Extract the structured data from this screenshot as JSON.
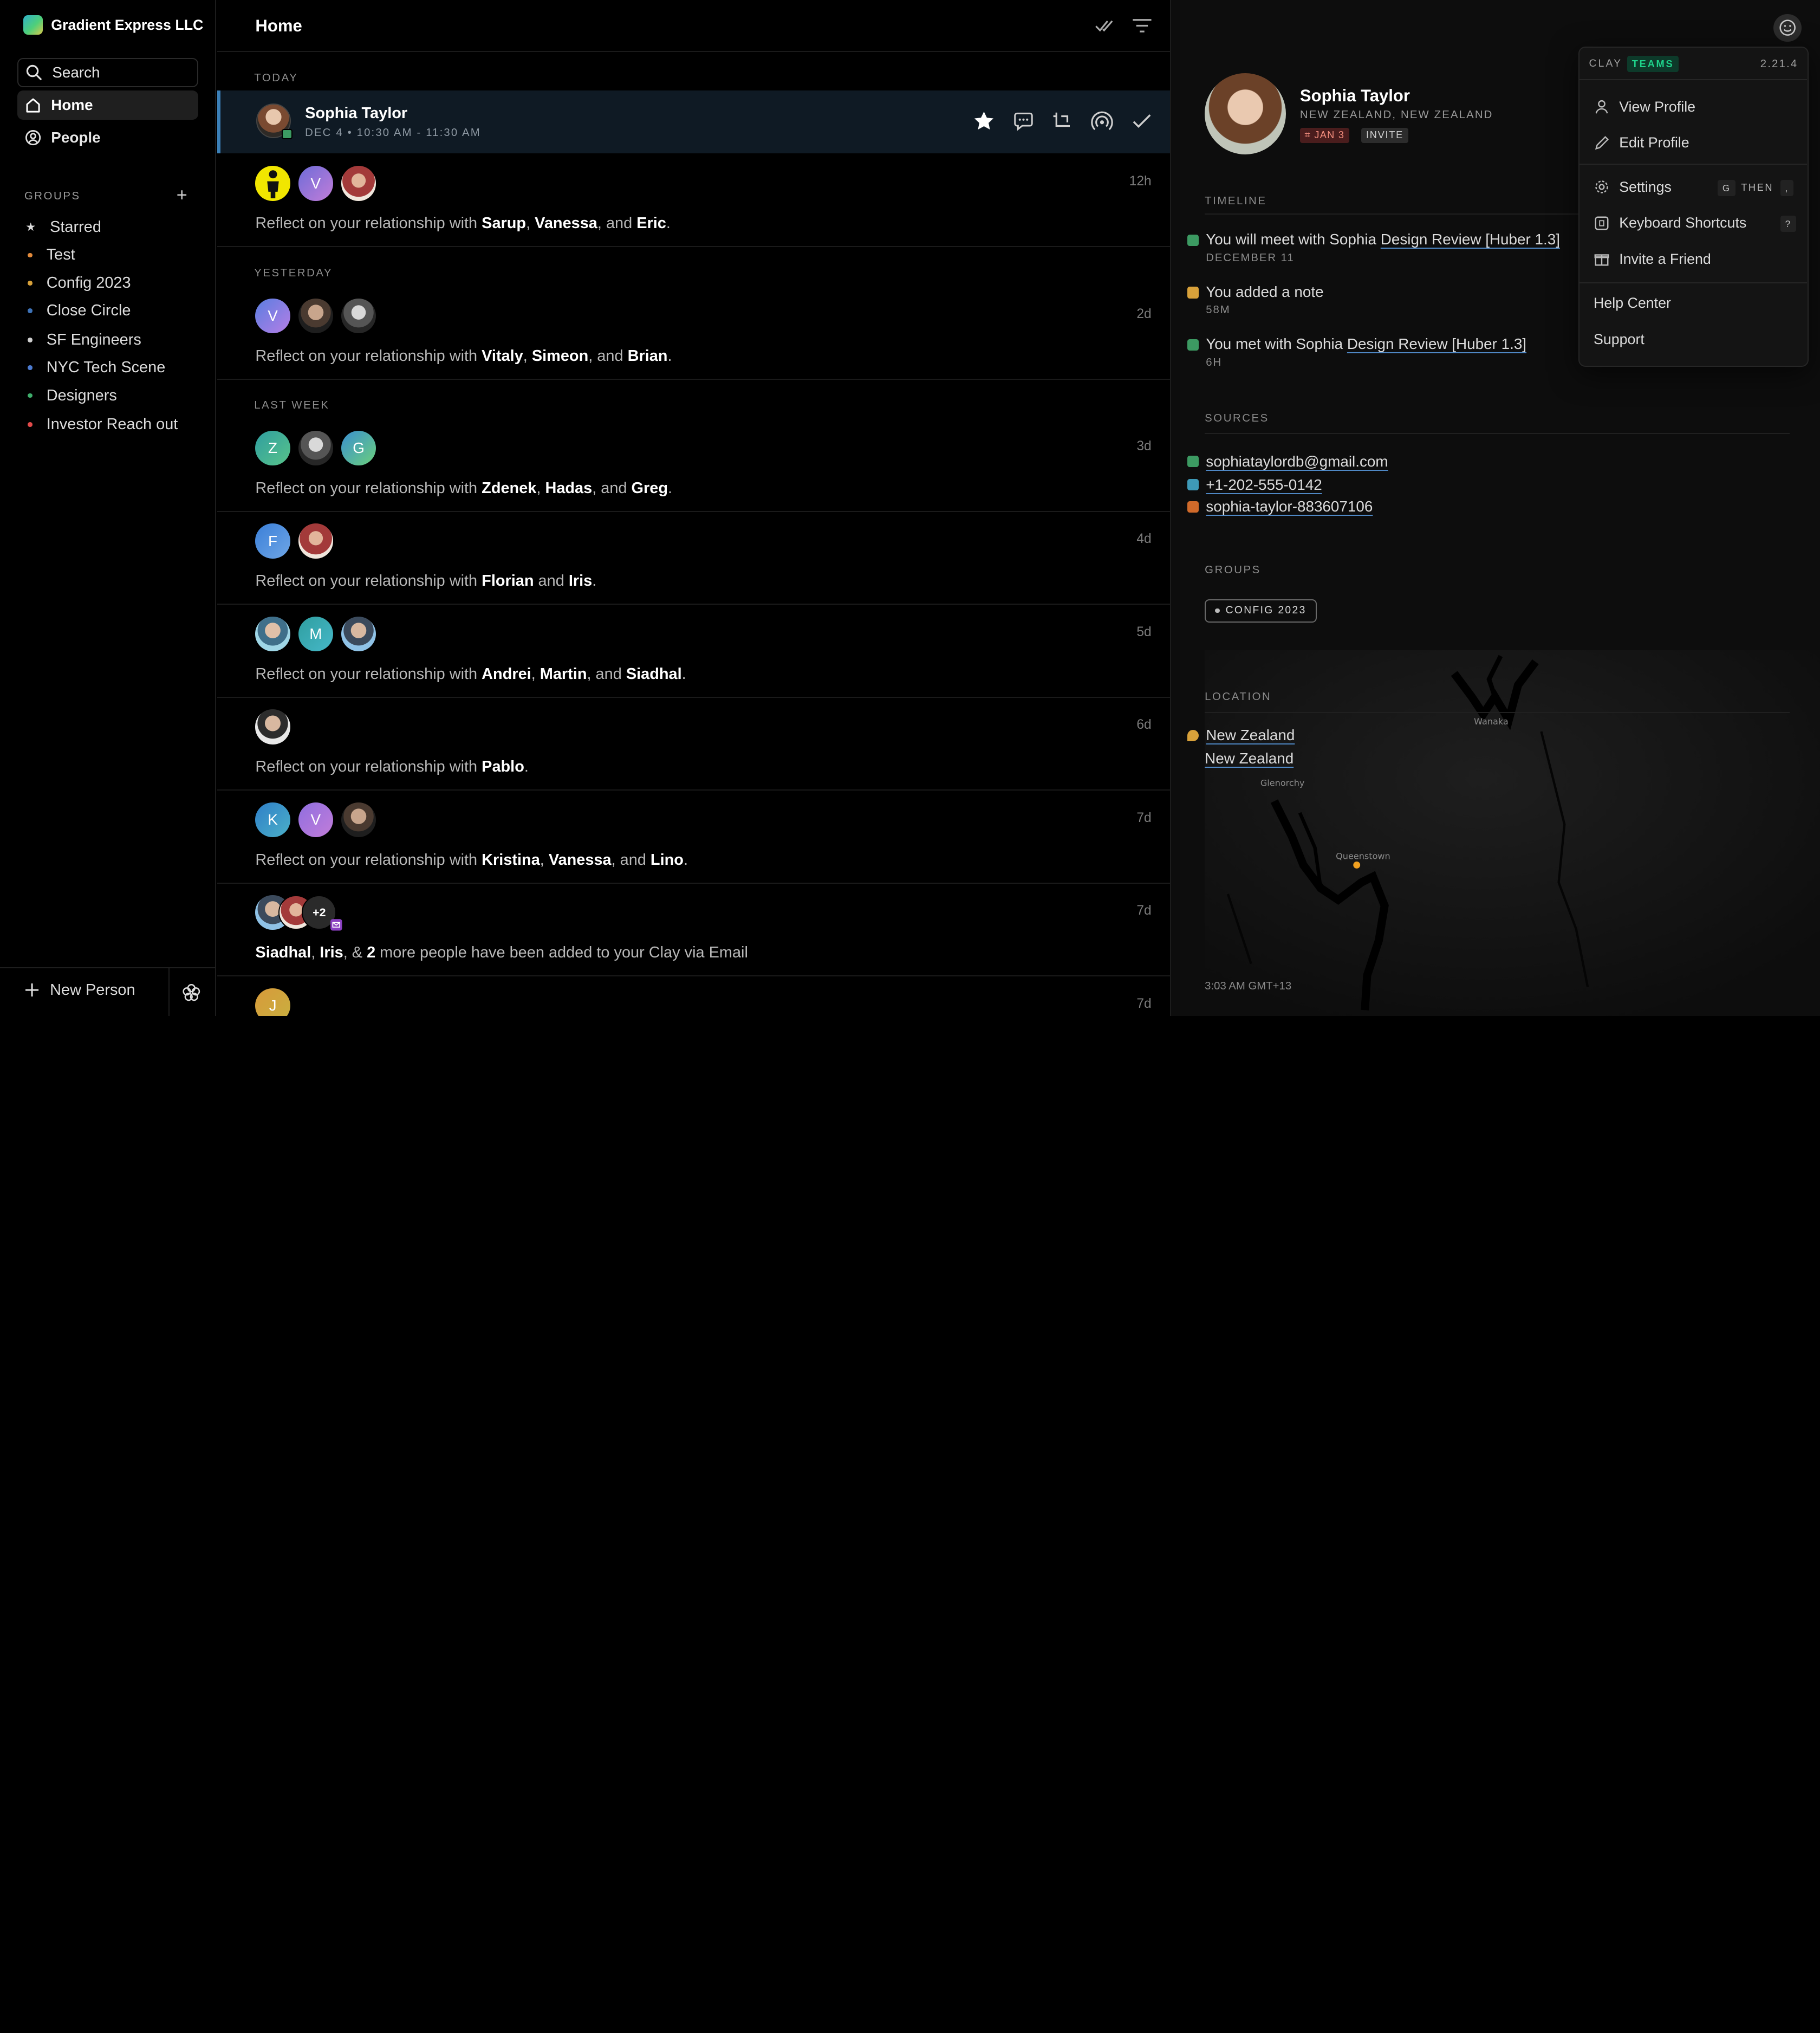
{
  "workspace": {
    "name": "Gradient Express LLC"
  },
  "sidebar": {
    "search_label": "Search",
    "nav": [
      {
        "label": "Home"
      },
      {
        "label": "People"
      }
    ],
    "groups_label": "GROUPS",
    "groups_add": "+",
    "groups": [
      {
        "label": "Starred",
        "color": "#dddddd"
      },
      {
        "label": "Test",
        "color": "#e28a3b"
      },
      {
        "label": "Config 2023",
        "color": "#d8a13a"
      },
      {
        "label": "Close Circle",
        "color": "#3e73b8"
      },
      {
        "label": "SF Engineers",
        "color": "#d0d0d0"
      },
      {
        "label": "NYC Tech Scene",
        "color": "#4c7bd0"
      },
      {
        "label": "Designers",
        "color": "#3fae6c"
      },
      {
        "label": "Investor Reach out",
        "color": "#e24a4a"
      }
    ],
    "new_person": "New Person"
  },
  "feed": {
    "title": "Home",
    "sections": {
      "today": "TODAY",
      "yesterday": "YESTERDAY",
      "last_week": "LAST WEEK"
    },
    "event": {
      "name": "Sophia Taylor",
      "time": "DEC 4 • 10:30 AM - 11:30 AM"
    },
    "rows": [
      {
        "time": "12h",
        "prefix": "Reflect on your relationship with ",
        "names": [
          "Sarup",
          "Vanessa",
          "Eric"
        ],
        "avatars": [
          "",
          "V",
          ""
        ]
      },
      {
        "time": "2d",
        "prefix": "Reflect on your relationship with ",
        "names": [
          "Vitaly",
          "Simeon",
          "Brian"
        ],
        "avatars": [
          "V",
          "",
          ""
        ]
      },
      {
        "time": "3d",
        "prefix": "Reflect on your relationship with ",
        "names": [
          "Zdenek",
          "Hadas",
          "Greg"
        ],
        "avatars": [
          "Z",
          "",
          "G"
        ]
      },
      {
        "time": "4d",
        "prefix": "Reflect on your relationship with ",
        "names": [
          "Florian",
          "Iris"
        ],
        "avatars": [
          "F",
          ""
        ]
      },
      {
        "time": "5d",
        "prefix": "Reflect on your relationship with ",
        "names": [
          "Andrei",
          "Martin",
          "Siadhal"
        ],
        "avatars": [
          "",
          "M",
          ""
        ]
      },
      {
        "time": "6d",
        "prefix": "Reflect on your relationship with ",
        "names": [
          "Pablo"
        ],
        "avatars": [
          ""
        ]
      },
      {
        "time": "7d",
        "prefix": "Reflect on your relationship with ",
        "names": [
          "Kristina",
          "Vanessa",
          "Lino"
        ],
        "avatars": [
          "K",
          "V",
          ""
        ]
      },
      {
        "time": "7d",
        "names": [
          "Siadhal",
          "Iris"
        ],
        "count": "2",
        "more_label": "+2",
        "suffix": " more people have been added to your Clay via Email"
      },
      {
        "time": "7d",
        "avatars": [
          "J"
        ]
      }
    ]
  },
  "profile": {
    "name": "Sophia Taylor",
    "location": "NEW ZEALAND, NEW ZEALAND",
    "date_tag": "JAN 3",
    "invite_tag": "INVITE",
    "timeline_label": "TIMELINE",
    "timeline": [
      {
        "text": "You will meet with Sophia ",
        "link": "Design Review [Huber 1.3]",
        "sub": "DECEMBER 11",
        "color": "#3c9a62"
      },
      {
        "text": "You added a note",
        "link": "",
        "sub": "58M",
        "color": "#d8a13a"
      },
      {
        "text": "You met with Sophia ",
        "link": "Design Review [Huber 1.3]",
        "sub": "6H",
        "color": "#3c9a62"
      }
    ],
    "sources_label": "SOURCES",
    "sources": [
      {
        "value": "sophiataylordb@gmail.com",
        "color": "#3c9a62"
      },
      {
        "value": "+1-202-555-0142",
        "color": "#3e9ab8"
      },
      {
        "value": "sophia-taylor-883607106",
        "color": "#d06a2a"
      }
    ],
    "groups_label": "GROUPS",
    "group_chip": "CONFIG 2023",
    "location_label": "LOCATION",
    "location_lines": [
      "New Zealand",
      "New Zealand"
    ],
    "map_labels": {
      "wanaka": "Wanaka",
      "glenorchy": "Glenorchy",
      "queenstown": "Queenstown"
    },
    "local_time": "3:03 AM GMT+13"
  },
  "menu": {
    "brand": "CLAY",
    "tier": "TEAMS",
    "version": "2.21.4",
    "items": [
      {
        "label": "View Profile"
      },
      {
        "label": "Edit Profile"
      },
      {
        "label": "Settings",
        "key1": "G",
        "then": "THEN",
        "key2": ","
      },
      {
        "label": "Keyboard Shortcuts",
        "key1": "?"
      },
      {
        "label": "Invite a Friend"
      },
      {
        "label": "Help Center"
      },
      {
        "label": "Support"
      }
    ]
  }
}
